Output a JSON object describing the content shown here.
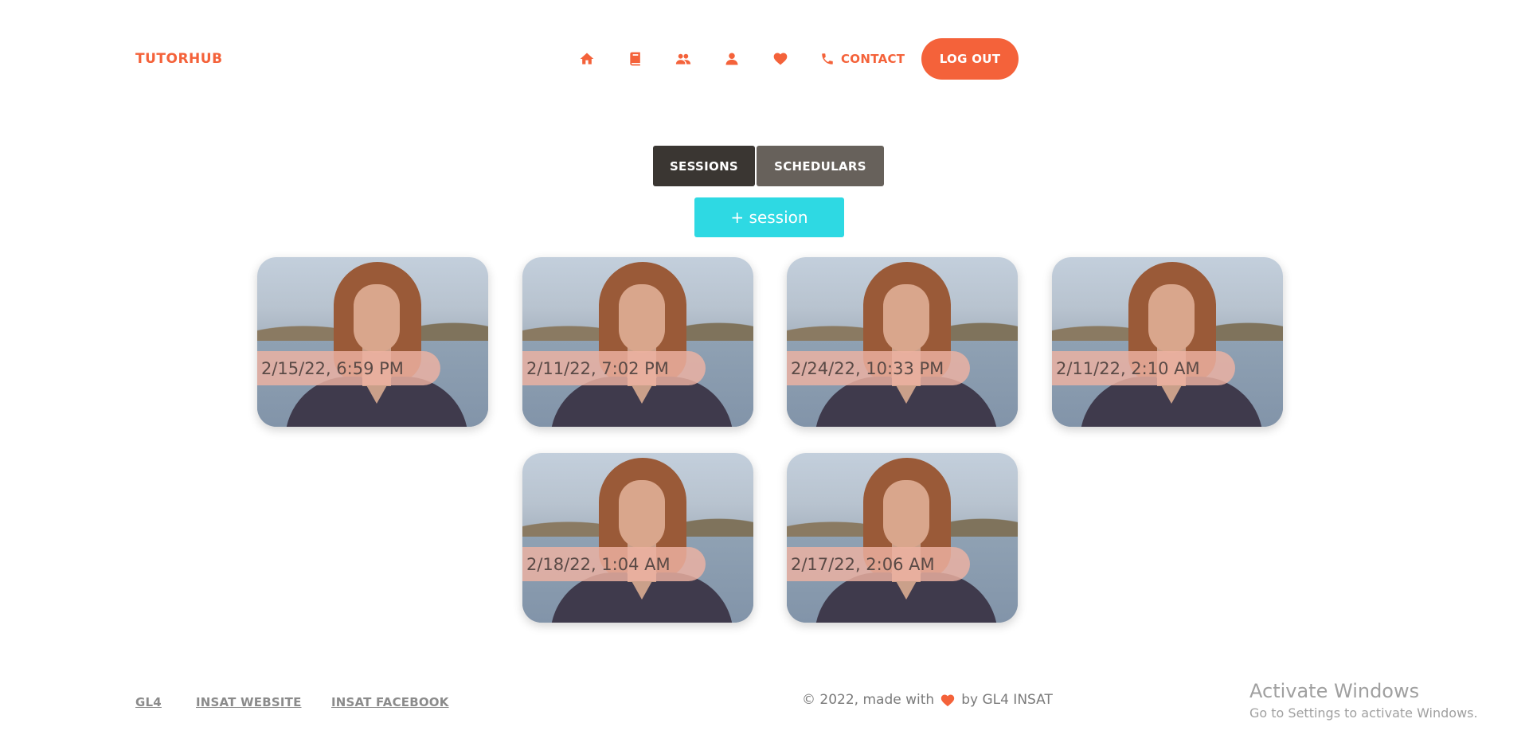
{
  "header": {
    "brand": "TUTORHUB",
    "nav_icons": [
      "home-icon",
      "book-icon",
      "users-icon",
      "user-icon",
      "heart-icon"
    ],
    "contact_icon": "phone-icon",
    "contact_label": "CONTACT",
    "logout_label": "LOG OUT"
  },
  "tabs": {
    "sessions_label": "SESSIONS",
    "schedulars_label": "SCHEDULARS",
    "active": "SESSIONS"
  },
  "add_session_label": "+ session",
  "sessions": [
    {
      "date": "2/15/22, 6:59 PM"
    },
    {
      "date": "2/11/22, 7:02 PM"
    },
    {
      "date": "2/24/22, 10:33 PM"
    },
    {
      "date": "2/11/22, 2:10 AM"
    },
    {
      "date": "2/18/22, 1:04 AM"
    },
    {
      "date": "2/17/22, 2:06 AM"
    }
  ],
  "footer": {
    "links": [
      "GL4",
      "INSAT WEBSITE",
      "INSAT FACEBOOK"
    ],
    "copyright_prefix": "© 2022, made with",
    "copyright_suffix": "by GL4 INSAT"
  },
  "watermark": {
    "title": "Activate Windows",
    "subtitle": "Go to Settings to activate Windows."
  },
  "colors": {
    "accent": "#f4623a",
    "session_button": "#2ed9e3",
    "tab_active": "#3a3632",
    "tab_inactive": "#67615b",
    "date_band": "#eeb2a2"
  }
}
